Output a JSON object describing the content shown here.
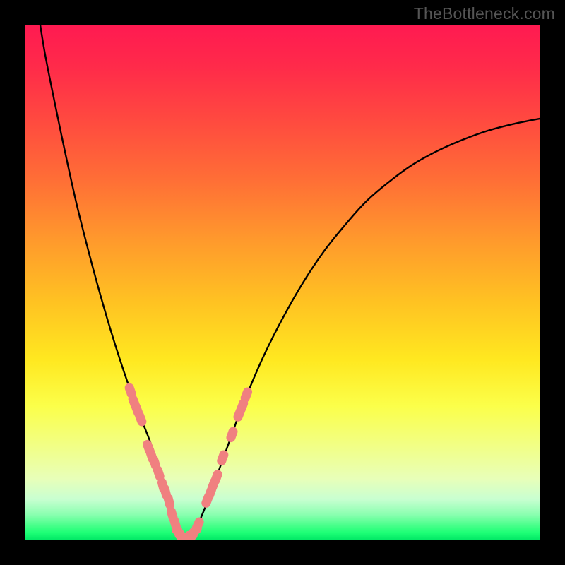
{
  "watermark": "TheBottleneck.com",
  "colors": {
    "curve": "#000000",
    "marker_fill": "#f08080",
    "marker_stroke": "#e36f6f",
    "frame": "#000000"
  },
  "chart_data": {
    "type": "line",
    "title": "",
    "xlabel": "",
    "ylabel": "",
    "xlim": [
      0,
      100
    ],
    "ylim": [
      0,
      100
    ],
    "grid": false,
    "legend": false,
    "series": [
      {
        "name": "bottleneck-curve",
        "x": [
          3,
          4,
          6,
          8,
          10,
          12,
          14,
          16,
          18,
          20,
          22,
          24,
          26,
          27,
          28,
          29,
          30,
          32,
          34,
          36,
          38,
          40,
          42,
          46,
          50,
          54,
          58,
          62,
          66,
          70,
          75,
          80,
          85,
          90,
          95,
          100
        ],
        "values": [
          100,
          94,
          84,
          74.5,
          65.5,
          57.5,
          50,
          43,
          36.5,
          30.5,
          25,
          20,
          14.5,
          11,
          7,
          3.5,
          0.3,
          0.3,
          4,
          9,
          14.5,
          20,
          25.5,
          35,
          43,
          50,
          56,
          61,
          65.5,
          69,
          72.7,
          75.5,
          77.7,
          79.5,
          80.8,
          81.8
        ]
      }
    ],
    "markers": [
      {
        "x": 20.5,
        "y": 29.0
      },
      {
        "x": 21.2,
        "y": 26.8
      },
      {
        "x": 21.8,
        "y": 25.3
      },
      {
        "x": 22.5,
        "y": 23.6
      },
      {
        "x": 24.0,
        "y": 18.0
      },
      {
        "x": 24.6,
        "y": 16.4
      },
      {
        "x": 25.2,
        "y": 15.1
      },
      {
        "x": 26.0,
        "y": 13.0
      },
      {
        "x": 26.8,
        "y": 10.6
      },
      {
        "x": 27.3,
        "y": 9.4
      },
      {
        "x": 28.0,
        "y": 7.5
      },
      {
        "x": 28.6,
        "y": 5.0
      },
      {
        "x": 29.2,
        "y": 3.2
      },
      {
        "x": 29.8,
        "y": 1.6
      },
      {
        "x": 30.4,
        "y": 0.6
      },
      {
        "x": 31.4,
        "y": 0.5
      },
      {
        "x": 32.2,
        "y": 0.6
      },
      {
        "x": 33.0,
        "y": 1.8
      },
      {
        "x": 33.6,
        "y": 3.0
      },
      {
        "x": 35.4,
        "y": 7.8
      },
      {
        "x": 36.0,
        "y": 9.2
      },
      {
        "x": 36.6,
        "y": 10.8
      },
      {
        "x": 37.2,
        "y": 12.2
      },
      {
        "x": 38.4,
        "y": 16.0
      },
      {
        "x": 40.2,
        "y": 20.5
      },
      {
        "x": 41.6,
        "y": 24.5
      },
      {
        "x": 42.2,
        "y": 26.0
      },
      {
        "x": 43.0,
        "y": 28.2
      }
    ]
  }
}
